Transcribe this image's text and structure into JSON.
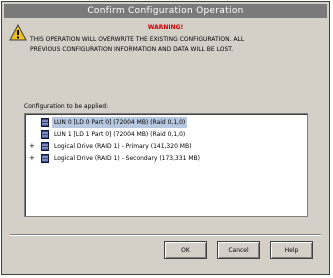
{
  "window": {
    "title": "Confirm Configuration Operation"
  },
  "warning": {
    "title": "WARNING!",
    "line1": "THIS OPERATION WILL OVERWRITE THE EXISTING CONFIGURATION. ALL",
    "line2": "PREVIOUS CONFIGURATION INFORMATION AND DATA WILL BE LOST."
  },
  "tree": {
    "label": "Configuration to be applied:",
    "rows": [
      {
        "expander": "",
        "text": "LUN 0 [LD 0 Part 0] (72004 MB) (Raid 0,1,0)",
        "selected": true
      },
      {
        "expander": "",
        "text": "LUN 1 [LD 1 Part 0] (72004 MB) (Raid 0,1,0)",
        "selected": false
      },
      {
        "expander": "+",
        "text": "Logical Drive (RAID 1) - Primary (141,320 MB)",
        "selected": false
      },
      {
        "expander": "+",
        "text": "Logical Drive (RAID 1) - Secondary (173,331 MB)",
        "selected": false
      }
    ]
  },
  "buttons": {
    "ok": "OK",
    "cancel": "Cancel",
    "help": "Help"
  },
  "colors": {
    "titlebar": "#7a7a7a",
    "warning_title": "#cc0000",
    "selection": "#b8c8e0"
  }
}
